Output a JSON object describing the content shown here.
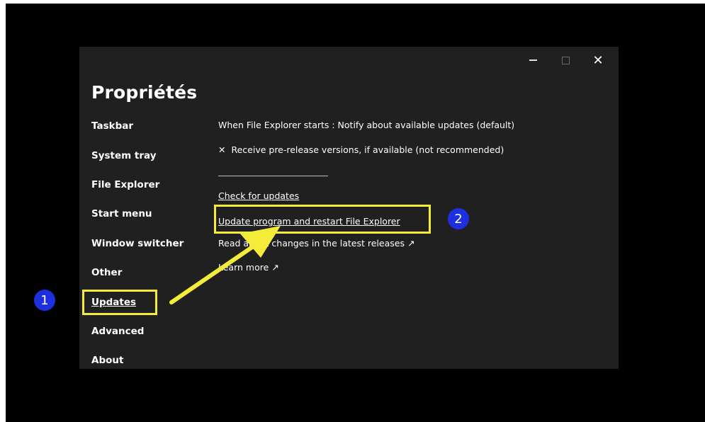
{
  "window": {
    "title": "Propriétés",
    "controls": {
      "minimize_icon": "minimize-icon",
      "maximize_icon": "maximize-icon",
      "close_symbol": "✕"
    }
  },
  "sidebar": {
    "items": [
      {
        "label": "Taskbar"
      },
      {
        "label": "System tray"
      },
      {
        "label": "File Explorer"
      },
      {
        "label": "Start menu"
      },
      {
        "label": "Window switcher"
      },
      {
        "label": "Other"
      },
      {
        "label": "Updates",
        "active": true
      },
      {
        "label": "Advanced"
      },
      {
        "label": "About"
      }
    ]
  },
  "content": {
    "update_mode": "When File Explorer starts : Notify about available updates (default)",
    "prerelease_mark": "✕",
    "prerelease_label": "Receive pre-release versions, if available (not recommended)",
    "check_updates": "Check for updates",
    "update_restart": "Update program and restart File Explorer",
    "read_changes": "Read about changes in the latest releases ↗",
    "learn_more": "Learn more ↗"
  },
  "annotations": {
    "badge_1": "1",
    "badge_2": "2",
    "highlight_color": "#f5ec3a",
    "badge_color": "#1e2fe0"
  },
  "colors": {
    "window_bg": "#202020",
    "outer_bg": "#000000",
    "text": "#ffffff"
  }
}
